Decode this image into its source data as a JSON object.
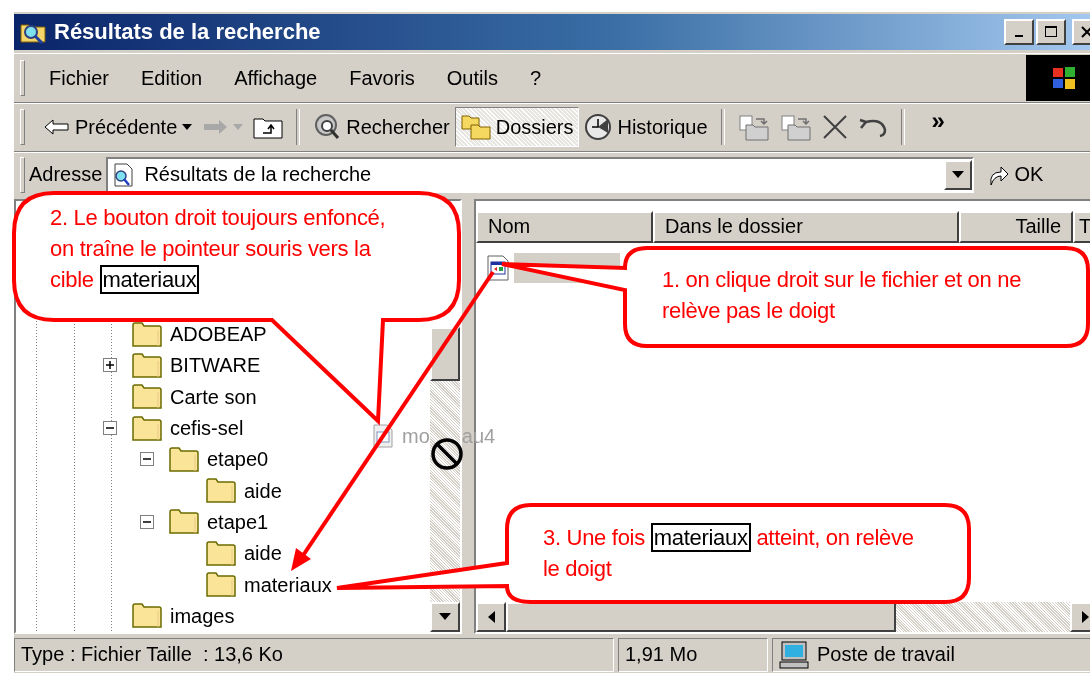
{
  "window": {
    "title": "Résultats de la recherche"
  },
  "menu": [
    {
      "label": "Fichier"
    },
    {
      "label": "Edition"
    },
    {
      "label": "Affichage"
    },
    {
      "label": "Favoris"
    },
    {
      "label": "Outils"
    },
    {
      "label": "?"
    }
  ],
  "toolbar": [
    {
      "kind": "back",
      "label": "Précédente",
      "disabled": false
    },
    {
      "kind": "forward",
      "disabled": true
    },
    {
      "kind": "up"
    },
    {
      "kind": "separator"
    },
    {
      "kind": "search",
      "label": "Rechercher",
      "selected": false
    },
    {
      "kind": "folders",
      "label": "Dossiers",
      "selected": true
    },
    {
      "kind": "history",
      "label": "Historique",
      "selected": false
    },
    {
      "kind": "separator"
    },
    {
      "kind": "move"
    },
    {
      "kind": "copy"
    },
    {
      "kind": "delete"
    },
    {
      "kind": "undo"
    },
    {
      "kind": "separator"
    },
    {
      "kind": "more",
      "label": "»"
    }
  ],
  "address": {
    "label": "Adresse",
    "value": "Résultats de la recherche",
    "go": "OK"
  },
  "tree": [
    {
      "label": "ADOBEAP"
    },
    {
      "label": "BITWARE",
      "expanded": false
    },
    {
      "label": "Carte son"
    },
    {
      "label": "cefis-sel",
      "expanded": true,
      "children": [
        {
          "label": "etape0",
          "expanded": true,
          "children": [
            {
              "label": "aide"
            }
          ]
        },
        {
          "label": "etape1",
          "expanded": true,
          "children": [
            {
              "label": "aide"
            },
            {
              "label": "materiaux"
            }
          ]
        }
      ]
    },
    {
      "label": "images"
    }
  ],
  "list": {
    "columns": [
      "Nom",
      "Dans le dossier",
      "Taille",
      "T"
    ],
    "rows": [
      {
        "selected": true
      }
    ]
  },
  "drag_ghost": {
    "parts": [
      "mo",
      "au4"
    ]
  },
  "callouts": [
    {
      "parts": [
        {
          "text": "2. Le bouton droit toujours enfoncé, on traîne le pointeur souris vers la cible ",
          "boxed": false
        },
        {
          "text": "materiaux",
          "boxed": true
        }
      ]
    },
    {
      "parts": [
        {
          "text": "1. on clique droit sur le fichier et on ne relève pas le doigt",
          "boxed": false
        }
      ]
    },
    {
      "parts": [
        {
          "text": "3. Une fois ",
          "boxed": false
        },
        {
          "text": "materiaux",
          "boxed": true
        },
        {
          "text": " atteint, on relève le doigt",
          "boxed": false
        }
      ]
    }
  ],
  "status_bar": [
    "Type : Fichier Taille  : 13,6 Ko",
    "1,91 Mo",
    "Poste de travail"
  ]
}
